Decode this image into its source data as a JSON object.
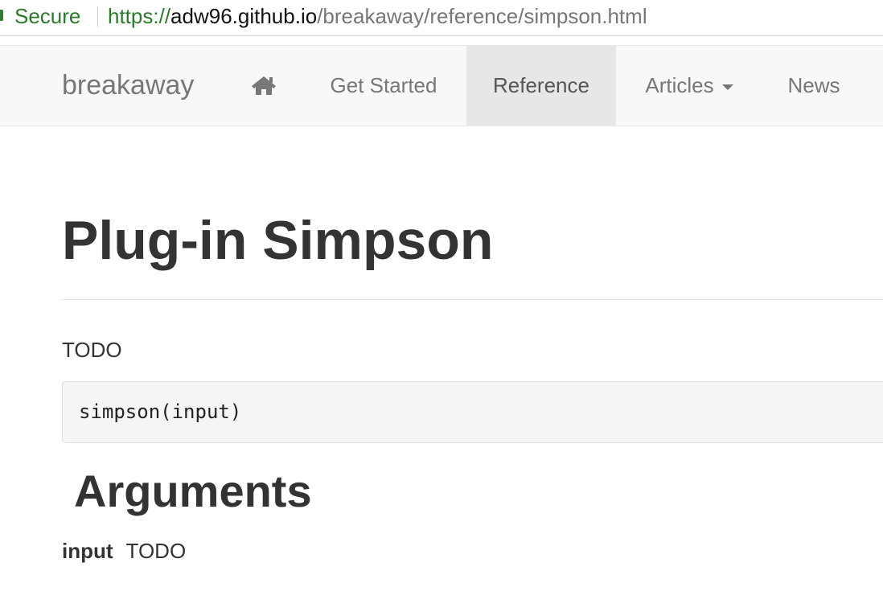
{
  "address_bar": {
    "secure_label": "Secure",
    "url_scheme": "https://",
    "url_host": "adw96.github.io",
    "url_path": "/breakaway/reference/simpson.html"
  },
  "navbar": {
    "brand": "breakaway",
    "home_icon": "home-icon",
    "items": [
      {
        "label": "Get Started"
      },
      {
        "label": "Reference",
        "active": true
      },
      {
        "label": "Articles",
        "dropdown": true
      },
      {
        "label": "News"
      }
    ]
  },
  "page": {
    "title": "Plug-in Simpson",
    "description": "TODO",
    "usage_code": "simpson(input)",
    "arguments_heading": "Arguments",
    "arguments": [
      {
        "name": "input",
        "description": "TODO"
      }
    ]
  },
  "colors": {
    "secure_green": "#2b7a2b",
    "navbar_bg": "#f8f8f8",
    "nav_active_bg": "#e7e7e7",
    "nav_text": "#777777",
    "body_text": "#333333",
    "code_bg": "#f5f5f5"
  }
}
